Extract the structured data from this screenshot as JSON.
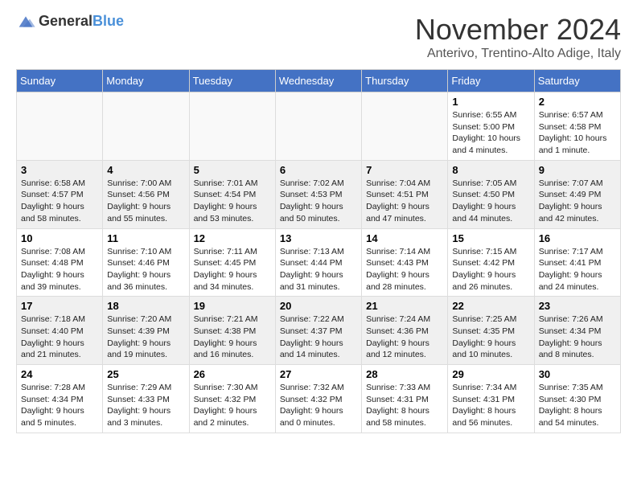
{
  "header": {
    "logo_general": "General",
    "logo_blue": "Blue",
    "month_title": "November 2024",
    "subtitle": "Anterivo, Trentino-Alto Adige, Italy"
  },
  "weekdays": [
    "Sunday",
    "Monday",
    "Tuesday",
    "Wednesday",
    "Thursday",
    "Friday",
    "Saturday"
  ],
  "weeks": [
    [
      {
        "day": "",
        "info": "",
        "row": "even"
      },
      {
        "day": "",
        "info": "",
        "row": "even"
      },
      {
        "day": "",
        "info": "",
        "row": "even"
      },
      {
        "day": "",
        "info": "",
        "row": "even"
      },
      {
        "day": "",
        "info": "",
        "row": "even"
      },
      {
        "day": "1",
        "info": "Sunrise: 6:55 AM\nSunset: 5:00 PM\nDaylight: 10 hours and 4 minutes.",
        "row": "even"
      },
      {
        "day": "2",
        "info": "Sunrise: 6:57 AM\nSunset: 4:58 PM\nDaylight: 10 hours and 1 minute.",
        "row": "even"
      }
    ],
    [
      {
        "day": "3",
        "info": "Sunrise: 6:58 AM\nSunset: 4:57 PM\nDaylight: 9 hours and 58 minutes.",
        "row": "odd"
      },
      {
        "day": "4",
        "info": "Sunrise: 7:00 AM\nSunset: 4:56 PM\nDaylight: 9 hours and 55 minutes.",
        "row": "odd"
      },
      {
        "day": "5",
        "info": "Sunrise: 7:01 AM\nSunset: 4:54 PM\nDaylight: 9 hours and 53 minutes.",
        "row": "odd"
      },
      {
        "day": "6",
        "info": "Sunrise: 7:02 AM\nSunset: 4:53 PM\nDaylight: 9 hours and 50 minutes.",
        "row": "odd"
      },
      {
        "day": "7",
        "info": "Sunrise: 7:04 AM\nSunset: 4:51 PM\nDaylight: 9 hours and 47 minutes.",
        "row": "odd"
      },
      {
        "day": "8",
        "info": "Sunrise: 7:05 AM\nSunset: 4:50 PM\nDaylight: 9 hours and 44 minutes.",
        "row": "odd"
      },
      {
        "day": "9",
        "info": "Sunrise: 7:07 AM\nSunset: 4:49 PM\nDaylight: 9 hours and 42 minutes.",
        "row": "odd"
      }
    ],
    [
      {
        "day": "10",
        "info": "Sunrise: 7:08 AM\nSunset: 4:48 PM\nDaylight: 9 hours and 39 minutes.",
        "row": "even"
      },
      {
        "day": "11",
        "info": "Sunrise: 7:10 AM\nSunset: 4:46 PM\nDaylight: 9 hours and 36 minutes.",
        "row": "even"
      },
      {
        "day": "12",
        "info": "Sunrise: 7:11 AM\nSunset: 4:45 PM\nDaylight: 9 hours and 34 minutes.",
        "row": "even"
      },
      {
        "day": "13",
        "info": "Sunrise: 7:13 AM\nSunset: 4:44 PM\nDaylight: 9 hours and 31 minutes.",
        "row": "even"
      },
      {
        "day": "14",
        "info": "Sunrise: 7:14 AM\nSunset: 4:43 PM\nDaylight: 9 hours and 28 minutes.",
        "row": "even"
      },
      {
        "day": "15",
        "info": "Sunrise: 7:15 AM\nSunset: 4:42 PM\nDaylight: 9 hours and 26 minutes.",
        "row": "even"
      },
      {
        "day": "16",
        "info": "Sunrise: 7:17 AM\nSunset: 4:41 PM\nDaylight: 9 hours and 24 minutes.",
        "row": "even"
      }
    ],
    [
      {
        "day": "17",
        "info": "Sunrise: 7:18 AM\nSunset: 4:40 PM\nDaylight: 9 hours and 21 minutes.",
        "row": "odd"
      },
      {
        "day": "18",
        "info": "Sunrise: 7:20 AM\nSunset: 4:39 PM\nDaylight: 9 hours and 19 minutes.",
        "row": "odd"
      },
      {
        "day": "19",
        "info": "Sunrise: 7:21 AM\nSunset: 4:38 PM\nDaylight: 9 hours and 16 minutes.",
        "row": "odd"
      },
      {
        "day": "20",
        "info": "Sunrise: 7:22 AM\nSunset: 4:37 PM\nDaylight: 9 hours and 14 minutes.",
        "row": "odd"
      },
      {
        "day": "21",
        "info": "Sunrise: 7:24 AM\nSunset: 4:36 PM\nDaylight: 9 hours and 12 minutes.",
        "row": "odd"
      },
      {
        "day": "22",
        "info": "Sunrise: 7:25 AM\nSunset: 4:35 PM\nDaylight: 9 hours and 10 minutes.",
        "row": "odd"
      },
      {
        "day": "23",
        "info": "Sunrise: 7:26 AM\nSunset: 4:34 PM\nDaylight: 9 hours and 8 minutes.",
        "row": "odd"
      }
    ],
    [
      {
        "day": "24",
        "info": "Sunrise: 7:28 AM\nSunset: 4:34 PM\nDaylight: 9 hours and 5 minutes.",
        "row": "even"
      },
      {
        "day": "25",
        "info": "Sunrise: 7:29 AM\nSunset: 4:33 PM\nDaylight: 9 hours and 3 minutes.",
        "row": "even"
      },
      {
        "day": "26",
        "info": "Sunrise: 7:30 AM\nSunset: 4:32 PM\nDaylight: 9 hours and 2 minutes.",
        "row": "even"
      },
      {
        "day": "27",
        "info": "Sunrise: 7:32 AM\nSunset: 4:32 PM\nDaylight: 9 hours and 0 minutes.",
        "row": "even"
      },
      {
        "day": "28",
        "info": "Sunrise: 7:33 AM\nSunset: 4:31 PM\nDaylight: 8 hours and 58 minutes.",
        "row": "even"
      },
      {
        "day": "29",
        "info": "Sunrise: 7:34 AM\nSunset: 4:31 PM\nDaylight: 8 hours and 56 minutes.",
        "row": "even"
      },
      {
        "day": "30",
        "info": "Sunrise: 7:35 AM\nSunset: 4:30 PM\nDaylight: 8 hours and 54 minutes.",
        "row": "even"
      }
    ]
  ]
}
